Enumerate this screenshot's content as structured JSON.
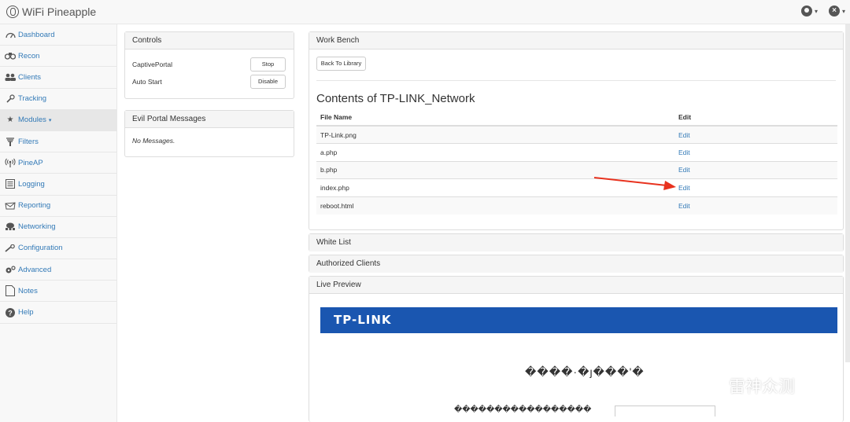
{
  "app": {
    "title": "WiFi Pineapple"
  },
  "navbar": {
    "user_icon": "user-circle-icon",
    "close_icon": "close-circle-icon",
    "caret": "▾"
  },
  "sidebar": {
    "items": [
      {
        "label": "Dashboard",
        "icon": "dashboard-icon"
      },
      {
        "label": "Recon",
        "icon": "binoculars-icon"
      },
      {
        "label": "Clients",
        "icon": "users-icon"
      },
      {
        "label": "Tracking",
        "icon": "wrench-icon"
      },
      {
        "label": "Modules",
        "icon": "star-icon",
        "caret": "▾",
        "active": true
      },
      {
        "label": "Filters",
        "icon": "filter-icon"
      },
      {
        "label": "PineAP",
        "icon": "broadcast-icon"
      },
      {
        "label": "Logging",
        "icon": "list-icon"
      },
      {
        "label": "Reporting",
        "icon": "envelope-icon"
      },
      {
        "label": "Networking",
        "icon": "network-icon"
      },
      {
        "label": "Configuration",
        "icon": "wrench-icon"
      },
      {
        "label": "Advanced",
        "icon": "cogs-icon"
      },
      {
        "label": "Notes",
        "icon": "file-icon"
      },
      {
        "label": "Help",
        "icon": "question-icon"
      }
    ]
  },
  "controls": {
    "title": "Controls",
    "rows": [
      {
        "label": "CaptivePortal",
        "button": "Stop"
      },
      {
        "label": "Auto Start",
        "button": "Disable"
      }
    ]
  },
  "evil_portal": {
    "title": "Evil Portal Messages",
    "empty": "No Messages."
  },
  "workbench": {
    "title": "Work Bench",
    "back_button": "Back To Library",
    "heading": "Contents of TP-LINK_Network",
    "columns": [
      "File Name",
      "Edit"
    ],
    "files": [
      {
        "name": "TP-Link.png",
        "edit": "Edit"
      },
      {
        "name": "a.php",
        "edit": "Edit"
      },
      {
        "name": "b.php",
        "edit": "Edit"
      },
      {
        "name": "index.php",
        "edit": "Edit"
      },
      {
        "name": "reboot.html",
        "edit": "Edit"
      }
    ]
  },
  "white_list": {
    "title": "White List"
  },
  "authorized_clients": {
    "title": "Authorized Clients"
  },
  "live_preview": {
    "title": "Live Preview",
    "logo_text": "TP-LINK",
    "banner_color": "#1a56b0",
    "garbled_line1": "����·�ȷ���ʹ�",
    "garbled_line2": "�����������������"
  },
  "watermark": {
    "text": "雷神众测"
  },
  "colors": {
    "link": "#337ab7",
    "annotation_arrow": "#e8321e"
  }
}
